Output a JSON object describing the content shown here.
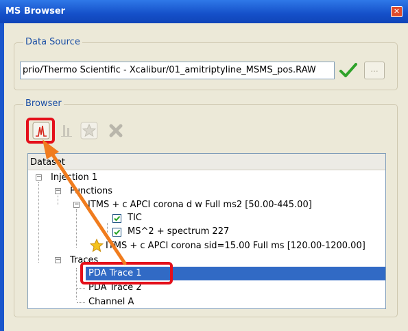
{
  "window": {
    "title": "MS Browser",
    "close_glyph": "✕"
  },
  "data_source": {
    "legend": "Data Source",
    "path_value": "prio/Thermo Scientific - Xcalibur/01_amitriptyline_MSMS_pos.RAW",
    "browse_label": "...",
    "valid_icon": "green-checkmark-icon"
  },
  "browser": {
    "legend": "Browser",
    "toolbar": [
      {
        "icon": "chromatogram-icon",
        "active": true
      },
      {
        "icon": "spectrum-bars-icon",
        "active": false
      },
      {
        "icon": "star-icon",
        "active": false
      },
      {
        "icon": "delete-x-icon",
        "active": false
      }
    ],
    "tree_header": "Dataset",
    "tree": {
      "injection": "Injection 1",
      "functions": "Functions",
      "function1": "ITMS + c APCI corona d w Full ms2  [50.00-445.00]",
      "tic": "TIC",
      "ms2": "MS^2 + spectrum 227",
      "function2": "ITMS + c APCI corona sid=15.00  Full ms [120.00-1200.00]",
      "traces": "Traces",
      "trace1": "PDA Trace 1",
      "trace2": "PDA Trace 2",
      "channel": "Channel A"
    }
  },
  "colors": {
    "highlight": "#e4101b",
    "arrow": "#f07c1e",
    "selection": "#316ac5",
    "titlebar": "#1550c9"
  }
}
